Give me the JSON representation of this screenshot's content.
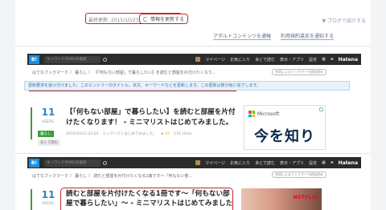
{
  "top": {
    "last_updated": "最終更新: 2015/10/23 22:04",
    "refresh_label": "情報を更新する",
    "blog_link": "▼ ブログで紹介する",
    "links": [
      "アダルトコンテンツを通報",
      "利用規約違反を通知する"
    ]
  },
  "toolbar_top": {
    "logo": "B!",
    "search_placeholder": "キーワードやURLを検索",
    "nav": [
      "マイページ",
      "お気に入り",
      "あとで読む",
      "表示・アプリ",
      "設定"
    ],
    "brand": "Hatena"
  },
  "entry1": {
    "breadcrumb": "はてなブックマーク 〉 暮らし 〉 【「何もない部屋」で暮らしたい】を読むと部屋を片付けたくなり…",
    "share_chip": "合同によるブックマーク追加済み",
    "notice": "更新要求を受け付けました。このエントリーのタイトル、本文、キーワードなどを更新します。この更新は数分後に完了します。",
    "count": "11",
    "users_label": "USERS",
    "title": "【「何もない部屋」で暮らしたい】を読むと部屋を片付けたくなります！ - ミニマリストはじめてみました。",
    "meta": [
      "2015/10/23 22:04",
      "ミニマリストはじめてみました。",
      "★ 37",
      "174 clicks"
    ],
    "category": "暮らし",
    "later_label": "あとで読む",
    "ad_brand": "Microsoft",
    "ad_headline": "今を知り"
  },
  "toolbar_bottom": {
    "logo": "B!",
    "search_placeholder": "キーワードやURLを検索",
    "nav": [
      "マイページ",
      "お気に入り",
      "あとで読む",
      "表示・アプリ",
      "設定"
    ],
    "brand": "Hatena"
  },
  "entry2": {
    "breadcrumb": "はてなブックマーク 〉 暮らし 〉 読むと部屋を片付けたくなる1冊です～「何もない部…",
    "share_chip": "合同によるブックマーク追加済み",
    "count": "11",
    "users_label": "USERS",
    "title": "読むと部屋を片付けたくなる1冊です～「何もない部屋で暮らしたい」～ - ミニマリストはじめてみました",
    "thumb_label": "NETFLIX"
  },
  "colors": {
    "highlight": "#c0272d",
    "accent": "#2a83c9",
    "bar": "#2b2b2b"
  }
}
